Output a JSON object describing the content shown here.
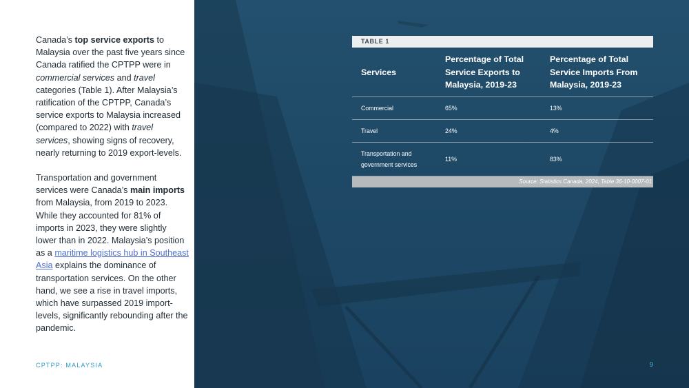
{
  "left": {
    "para1": [
      {
        "text": "Canada’s ",
        "style": "normal"
      },
      {
        "text": "top service exports",
        "style": "bold"
      },
      {
        "text": " to Malaysia over the past five years since Canada ratified the CPTPP were in ",
        "style": "normal"
      },
      {
        "text": "commercial services",
        "style": "italic"
      },
      {
        "text": " and ",
        "style": "normal"
      },
      {
        "text": "travel",
        "style": "italic"
      },
      {
        "text": " categories (Table 1). After Malaysia’s ratification of the CPTPP, Canada’s service exports to Malaysia increased (compared to 2022) with ",
        "style": "normal"
      },
      {
        "text": "travel services",
        "style": "italic"
      },
      {
        "text": ", showing signs of recovery, nearly returning to 2019 export-levels.",
        "style": "normal"
      }
    ],
    "para2": [
      {
        "text": "Transportation and government services were Canada’s ",
        "style": "normal"
      },
      {
        "text": "main imports",
        "style": "bold"
      },
      {
        "text": " from Malaysia, from 2019 to 2023. While they accounted for 81% of imports in 2023, they were slightly lower than in 2022. Malaysia’s position as a ",
        "style": "normal"
      },
      {
        "text": "maritime logistics hub in Southeast Asia",
        "style": "link"
      },
      {
        "text": " explains the dominance of transportation services. On the other hand, we see a rise in travel imports, which have surpassed 2019 import-levels, significantly rebounding after the pandemic.",
        "style": "normal"
      }
    ],
    "footer": "CPTPP: MALAYSIA"
  },
  "table": {
    "label": "TABLE 1",
    "headers": [
      "Services",
      "Percentage of Total Service Exports to Malaysia, 2019-23",
      "Percentage of Total Service Imports From Malaysia, 2019-23"
    ],
    "rows": [
      [
        "Commercial",
        "65%",
        "13%"
      ],
      [
        "Travel",
        "24%",
        "4%"
      ],
      [
        "Transportation and government services",
        "11%",
        "83%"
      ]
    ],
    "source": "Source: Statistics Canada, 2024, Table 36-10-0007-01"
  },
  "page_number": "9",
  "colors": {
    "panel": "#1e4966",
    "accent": "#2a9ac6",
    "link": "#4f6fd1",
    "source_bar": "#b7babd",
    "label_bar": "#eceeef"
  }
}
